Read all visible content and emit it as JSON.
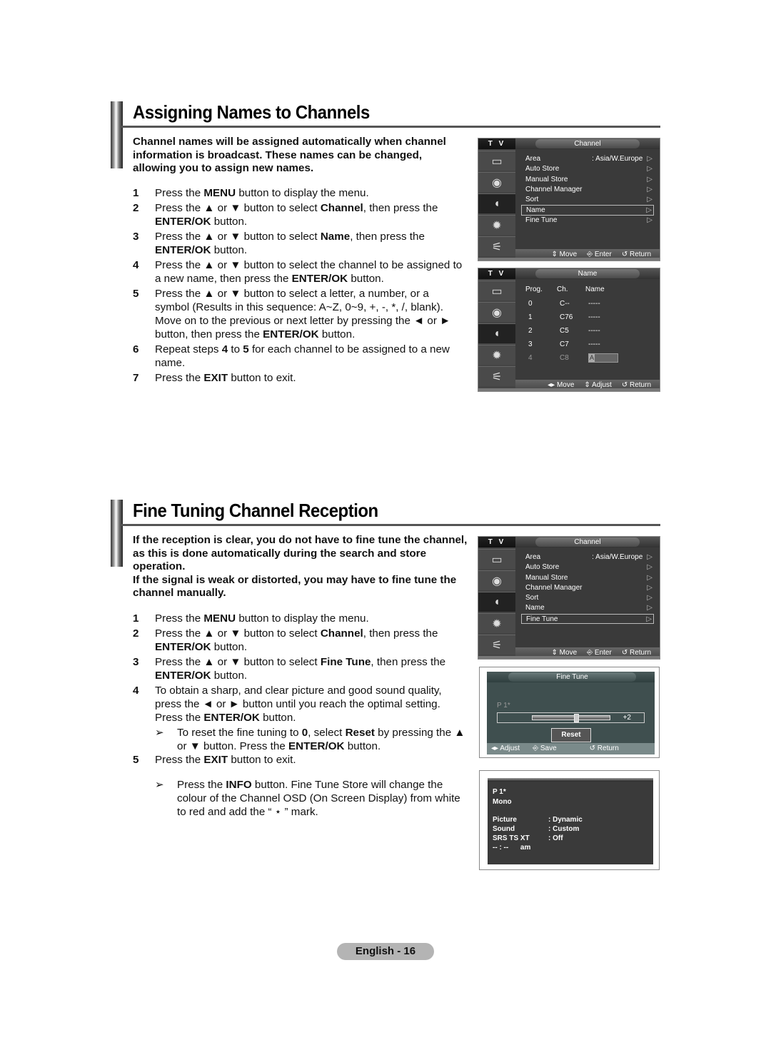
{
  "section1": {
    "title": "Assigning Names to Channels",
    "intro": "Channel names will be assigned automatically when channel information is broadcast. These names can be changed, allowing you to assign new names.",
    "steps": [
      {
        "num": "1",
        "parts": [
          [
            "Press the ",
            ""
          ],
          [
            "MENU",
            "b"
          ],
          [
            " button to display the menu.",
            ""
          ]
        ]
      },
      {
        "num": "2",
        "parts": [
          [
            "Press the ▲ or ▼ button to select ",
            ""
          ],
          [
            "Channel",
            "b"
          ],
          [
            ", then press the ",
            ""
          ],
          [
            "ENTER/OK",
            "b"
          ],
          [
            " button.",
            ""
          ]
        ]
      },
      {
        "num": "3",
        "parts": [
          [
            "Press the ▲ or ▼ button to select ",
            ""
          ],
          [
            "Name",
            "b"
          ],
          [
            ", then press the ",
            ""
          ],
          [
            "ENTER/OK",
            "b"
          ],
          [
            " button.",
            ""
          ]
        ]
      },
      {
        "num": "4",
        "parts": [
          [
            "Press the ▲ or ▼ button to select the channel to be assigned to a new name, then press the ",
            ""
          ],
          [
            "ENTER/OK",
            "b"
          ],
          [
            " button.",
            ""
          ]
        ]
      },
      {
        "num": "5",
        "parts": [
          [
            "Press the ▲ or ▼ button to select a letter, a number, or a symbol (Results in this sequence: A~Z, 0~9, +, -, *, /, blank). Move on to the previous or next letter by pressing the ◄ or ► button, then press the ",
            ""
          ],
          [
            "ENTER/OK",
            "b"
          ],
          [
            " button.",
            ""
          ]
        ]
      },
      {
        "num": "6",
        "parts": [
          [
            "Repeat steps ",
            ""
          ],
          [
            "4",
            "b"
          ],
          [
            " to ",
            ""
          ],
          [
            "5",
            "b"
          ],
          [
            " for each channel to be assigned to a new name.",
            ""
          ]
        ]
      },
      {
        "num": "7",
        "parts": [
          [
            "Press the ",
            ""
          ],
          [
            "EXIT",
            "b"
          ],
          [
            " button to exit.",
            ""
          ]
        ]
      }
    ]
  },
  "section2": {
    "title": "Fine Tuning Channel Reception",
    "intro1": "If the reception is clear, you do not have to fine tune the channel, as this is done automatically during the search and store operation.",
    "intro2": "If the signal is weak or distorted, you may have to fine tune the channel manually.",
    "steps": [
      {
        "num": "1",
        "parts": [
          [
            "Press the ",
            ""
          ],
          [
            "MENU",
            "b"
          ],
          [
            " button to display the menu.",
            ""
          ]
        ]
      },
      {
        "num": "2",
        "parts": [
          [
            "Press the ▲ or ▼ button to select ",
            ""
          ],
          [
            "Channel",
            "b"
          ],
          [
            ", then press the ",
            ""
          ],
          [
            "ENTER/OK",
            "b"
          ],
          [
            " button.",
            ""
          ]
        ]
      },
      {
        "num": "3",
        "parts": [
          [
            "Press the ▲ or ▼ button to select ",
            ""
          ],
          [
            "Fine Tune",
            "b"
          ],
          [
            ", then press the ",
            ""
          ],
          [
            "ENTER/OK",
            "b"
          ],
          [
            " button.",
            ""
          ]
        ]
      },
      {
        "num": "4",
        "parts": [
          [
            "To obtain a sharp, and clear picture and good sound quality, press the ◄ or ► button until you reach the optimal setting. Press the ",
            ""
          ],
          [
            "ENTER/OK",
            "b"
          ],
          [
            " button.",
            ""
          ]
        ]
      },
      {
        "num": "5",
        "parts": [
          [
            "Press the ",
            ""
          ],
          [
            "EXIT",
            "b"
          ],
          [
            " button to exit.",
            ""
          ]
        ]
      }
    ],
    "note_reset": [
      [
        "To reset the fine tuning to ",
        ""
      ],
      [
        "0",
        "b"
      ],
      [
        ", select ",
        ""
      ],
      [
        "Reset",
        "b"
      ],
      [
        " by pressing the ▲ or ▼ button. Press the ",
        ""
      ],
      [
        "ENTER/OK",
        "b"
      ],
      [
        " button.",
        ""
      ]
    ],
    "note_info": [
      [
        "Press the ",
        ""
      ],
      [
        "INFO",
        "b"
      ],
      [
        " button. Fine Tune Store will change the colour of the Channel OSD (On Screen Display) from white to red and add the “ ⋆ ” mark.",
        ""
      ]
    ],
    "note_arrow": "➢"
  },
  "osd": {
    "tv_label": "T V",
    "icons": [
      "picture-icon",
      "sound-icon",
      "channel-icon",
      "setup-icon",
      "input-icon"
    ],
    "channel_menu": {
      "title": "Channel",
      "items": [
        {
          "label": "Area",
          "value": ": Asia/W.Europe"
        },
        {
          "label": "Auto Store",
          "value": ""
        },
        {
          "label": "Manual Store",
          "value": ""
        },
        {
          "label": "Channel Manager",
          "value": ""
        },
        {
          "label": "Sort",
          "value": ""
        },
        {
          "label": "Name",
          "value": ""
        },
        {
          "label": "Fine Tune",
          "value": ""
        }
      ],
      "chevron": "▷",
      "footer": {
        "move": "⇕ Move",
        "enter": "⎆ Enter",
        "return": "↺ Return"
      }
    },
    "name_menu": {
      "title": "Name",
      "headers": [
        "Prog.",
        "Ch.",
        "Name"
      ],
      "rows": [
        {
          "prog": "0",
          "ch": "C--",
          "name": "-----"
        },
        {
          "prog": "1",
          "ch": "C76",
          "name": "-----"
        },
        {
          "prog": "2",
          "ch": "C5",
          "name": "-----"
        },
        {
          "prog": "3",
          "ch": "C7",
          "name": "-----"
        },
        {
          "prog": "4",
          "ch": "C8",
          "name": "A"
        }
      ],
      "footer": {
        "move": "◂▸ Move",
        "adjust": "⇕ Adjust",
        "return": "↺ Return"
      }
    },
    "fine_tune": {
      "title": "Fine Tune",
      "program": "P  1*",
      "value_label": "+2",
      "value": 2,
      "reset_label": "Reset",
      "footer": {
        "adjust": "◂▸ Adjust",
        "save": "⎆ Save",
        "return": "↺ Return"
      }
    },
    "info": {
      "program": "P  1*",
      "audio": "Mono",
      "rows": [
        {
          "k": "Picture",
          "v": ": Dynamic"
        },
        {
          "k": "Sound",
          "v": ": Custom"
        },
        {
          "k": "SRS TS XT",
          "v": ": Off"
        }
      ],
      "clock": "-- : --      am"
    }
  },
  "footer": {
    "page_label": "English - 16"
  }
}
